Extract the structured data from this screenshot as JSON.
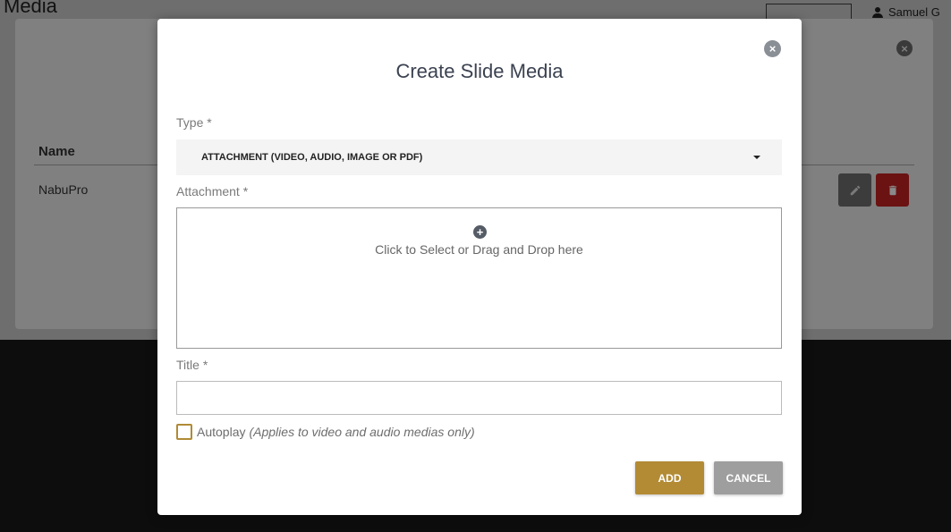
{
  "background": {
    "page_title": "Media",
    "user_name": "Samuel G",
    "table_header_name": "Name",
    "rows": [
      {
        "name": "NabuPro"
      }
    ]
  },
  "modal": {
    "title": "Create Slide Media",
    "type_label": "Type *",
    "type_value": "ATTACHMENT (VIDEO, AUDIO, IMAGE OR PDF)",
    "attachment_label": "Attachment *",
    "dropzone_text": "Click to Select or Drag and Drop here",
    "title_label": "Title *",
    "title_value": "",
    "autoplay_label": "Autoplay",
    "autoplay_note": "(Applies to video and audio medias only)",
    "add_label": "ADD",
    "cancel_label": "CANCEL"
  },
  "colors": {
    "accent": "#b28b34",
    "cancel": "#9e9e9e",
    "delete": "#c62828"
  },
  "icons": {
    "close": "close-circle-icon",
    "plus": "plus-circle-icon",
    "edit": "pencil-icon",
    "delete": "trash-icon",
    "user": "person-icon",
    "caret": "caret-down-icon"
  }
}
